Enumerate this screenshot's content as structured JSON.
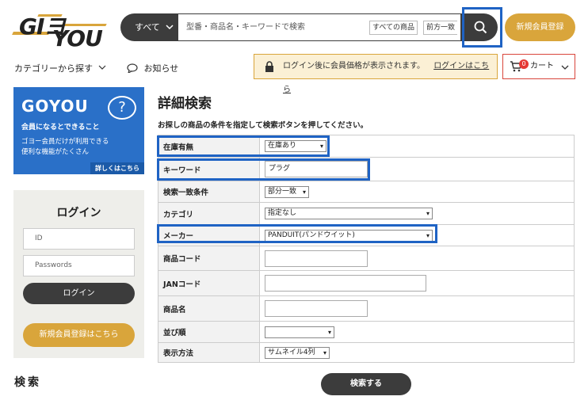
{
  "logo": {
    "line1": "GIヨ",
    "line2": "YOU"
  },
  "header": {
    "category_label": "すべて",
    "search_placeholder": "型番・商品名・キーワードで検索",
    "scope_select": "すべての商品",
    "match_select": "前方一致",
    "signup_label": "新規会員登録"
  },
  "subnav": {
    "category_label": "カテゴリーから探す",
    "news_label": "お知らせ",
    "notice_text": "ログイン後に会員価格が表示されます。",
    "notice_link": "ログインはこちら",
    "cart_label": "カート",
    "cart_count": "0"
  },
  "sidebar": {
    "banner_title": "GOYOU",
    "banner_q": "?",
    "banner_sub": "会員になるとできること",
    "banner_line1": "ゴヨー会員だけが利用できる",
    "banner_line2": "便利な機能がたくさん",
    "banner_more": "詳しくはこちら",
    "login_title": "ログイン",
    "id_placeholder": "ID",
    "password_placeholder": "Passwords",
    "login_button": "ログイン",
    "signup_button": "新規会員登録はこちら",
    "search_heading": "検索"
  },
  "main": {
    "title": "詳細検索",
    "description": "お探しの商品の条件を指定して検索ボタンを押してください。",
    "rows": [
      {
        "label": "在庫有無",
        "value": "在庫あり"
      },
      {
        "label": "キーワード",
        "value": "プラグ"
      },
      {
        "label": "検索一致条件",
        "value": "部分一致"
      },
      {
        "label": "カテゴリ",
        "value": "指定なし"
      },
      {
        "label": "メーカー",
        "value": "PANDUIT(パンドウイット)"
      },
      {
        "label": "商品コード",
        "value": ""
      },
      {
        "label": "JANコード",
        "value": ""
      },
      {
        "label": "商品名",
        "value": ""
      },
      {
        "label": "並び順",
        "value": ""
      },
      {
        "label": "表示方法",
        "value": "サムネイル4列"
      }
    ],
    "submit_label": "検索する"
  },
  "colors": {
    "accent_gold": "#d9a53b",
    "highlight_blue": "#1f63c4",
    "dark": "#3c3c3c",
    "banner_blue": "#2a70c8"
  }
}
